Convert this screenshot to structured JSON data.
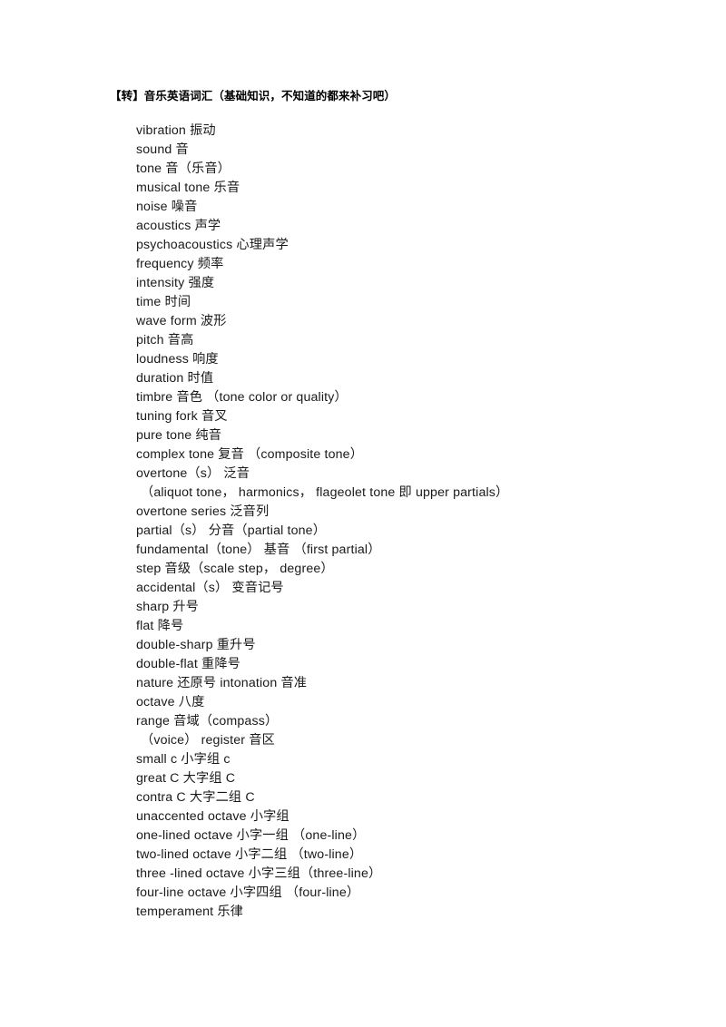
{
  "document": {
    "title": "【转】音乐英语词汇（基础知识，不知道的都来补习吧）",
    "background_color": "#ffffff",
    "text_color": "#000000",
    "entries": [
      {
        "text": "vibration 振动",
        "continuation": false
      },
      {
        "text": "sound 音",
        "continuation": false
      },
      {
        "text": "tone 音（乐音）",
        "continuation": false
      },
      {
        "text": "musical tone 乐音",
        "continuation": false
      },
      {
        "text": "noise 噪音",
        "continuation": false
      },
      {
        "text": "acoustics 声学",
        "continuation": false
      },
      {
        "text": "psychoacoustics 心理声学",
        "continuation": false
      },
      {
        "text": "frequency 频率",
        "continuation": false
      },
      {
        "text": "intensity 强度",
        "continuation": false
      },
      {
        "text": "time 时间",
        "continuation": false
      },
      {
        "text": "wave form 波形",
        "continuation": false
      },
      {
        "text": "pitch 音高",
        "continuation": false
      },
      {
        "text": "loudness 响度",
        "continuation": false
      },
      {
        "text": "duration 时值",
        "continuation": false
      },
      {
        "text": "timbre 音色 （tone color or quality）",
        "continuation": false
      },
      {
        "text": "tuning fork 音叉",
        "continuation": false
      },
      {
        "text": "pure tone 纯音",
        "continuation": false
      },
      {
        "text": "complex tone 复音 （composite tone）",
        "continuation": false
      },
      {
        "text": "overtone（s） 泛音",
        "continuation": false
      },
      {
        "text": "（aliquot tone， harmonics， flageolet tone 即 upper partials）",
        "continuation": true
      },
      {
        "text": "overtone series 泛音列",
        "continuation": false
      },
      {
        "text": "partial（s） 分音（partial tone）",
        "continuation": false
      },
      {
        "text": "fundamental（tone） 基音 （first partial）",
        "continuation": false
      },
      {
        "text": "step 音级（scale step， degree）",
        "continuation": false
      },
      {
        "text": "accidental（s） 变音记号",
        "continuation": false
      },
      {
        "text": "sharp 升号",
        "continuation": false
      },
      {
        "text": "flat 降号",
        "continuation": false
      },
      {
        "text": "double-sharp 重升号",
        "continuation": false
      },
      {
        "text": "double-flat 重降号",
        "continuation": false
      },
      {
        "text": "nature 还原号 intonation 音准",
        "continuation": false
      },
      {
        "text": "octave 八度",
        "continuation": false
      },
      {
        "text": "range 音域（compass）",
        "continuation": false
      },
      {
        "text": "（voice） register 音区",
        "continuation": true
      },
      {
        "text": "small c 小字组 c",
        "continuation": false
      },
      {
        "text": "great C 大字组 C",
        "continuation": false
      },
      {
        "text": "contra C 大字二组 C",
        "continuation": false
      },
      {
        "text": "unaccented octave 小字组",
        "continuation": false
      },
      {
        "text": "one-lined octave 小字一组 （one-line）",
        "continuation": false
      },
      {
        "text": "two-lined octave 小字二组 （two-line）",
        "continuation": false
      },
      {
        "text": "three -lined octave 小字三组（three-line）",
        "continuation": false
      },
      {
        "text": "four-line octave 小字四组 （four-line）",
        "continuation": false
      },
      {
        "text": "temperament 乐律",
        "continuation": false
      }
    ]
  }
}
